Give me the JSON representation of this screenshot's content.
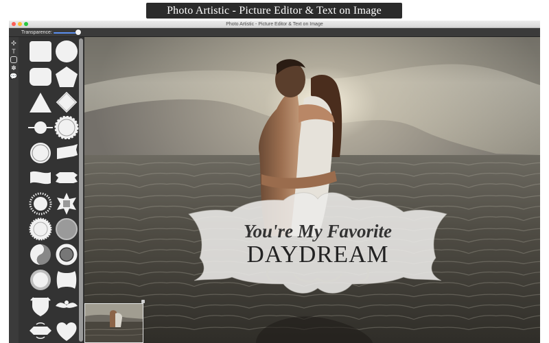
{
  "banner": {
    "text": "Photo Artistic - Picture Editor & Text on Image"
  },
  "window": {
    "title": "Photo Artistic - Picture Editor & Text on Image"
  },
  "toolbar": {
    "transparence_label": "Transparence:",
    "transparence_value": 0.85
  },
  "tools": [
    {
      "name": "move-icon",
      "glyph": "✣"
    },
    {
      "name": "text-tool-icon",
      "glyph": "T"
    },
    {
      "name": "shape-tool-icon",
      "glyph": "▢"
    },
    {
      "name": "gear-icon",
      "glyph": "✽"
    },
    {
      "name": "speech-bubble-icon",
      "glyph": "💬"
    }
  ],
  "shapes": [
    "rounded-square",
    "circle",
    "rounded-rectangle",
    "pentagon",
    "triangle",
    "diamond",
    "circle-with-lines",
    "scalloped-circle",
    "ring-circle",
    "ribbon-flag",
    "banner-wave",
    "ribbon-banner",
    "sunburst",
    "star-badge",
    "gear-badge",
    "grey-circle",
    "split-circle",
    "ring",
    "seal-circle",
    "ornate-label",
    "shield-crest",
    "winged-ornament",
    "ornate-banner",
    "heart"
  ],
  "canvas": {
    "overlay": {
      "line1": "You're My Favorite",
      "line2": "DAYDREAM"
    }
  }
}
